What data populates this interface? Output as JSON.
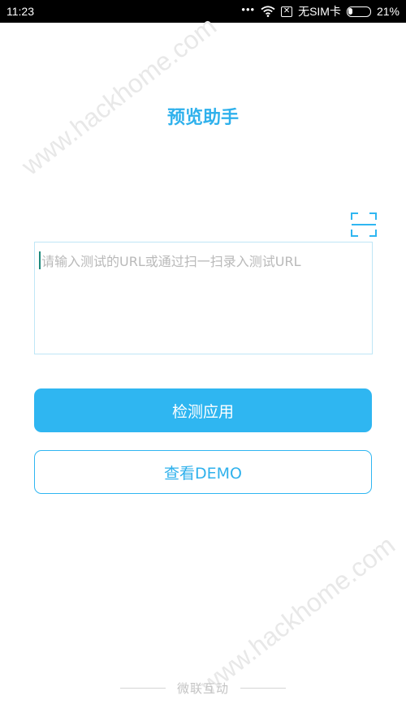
{
  "status_bar": {
    "time": "11:23",
    "signal_dots": "•••",
    "sim_label": "无SIM卡",
    "battery_percent": 21,
    "battery_text": "21%"
  },
  "watermark": {
    "text": "www.hackhome.com"
  },
  "main": {
    "title": "预览助手",
    "url_input": {
      "placeholder": "请输入测试的URL或通过扫一扫录入测试URL",
      "value": ""
    },
    "check_button_label": "检测应用",
    "demo_button_label": "查看DEMO"
  },
  "footer": {
    "text": "微联互动"
  },
  "colors": {
    "accent": "#2fb6f1",
    "title": "#2fb1ec",
    "status_bar_bg": "#000000"
  }
}
